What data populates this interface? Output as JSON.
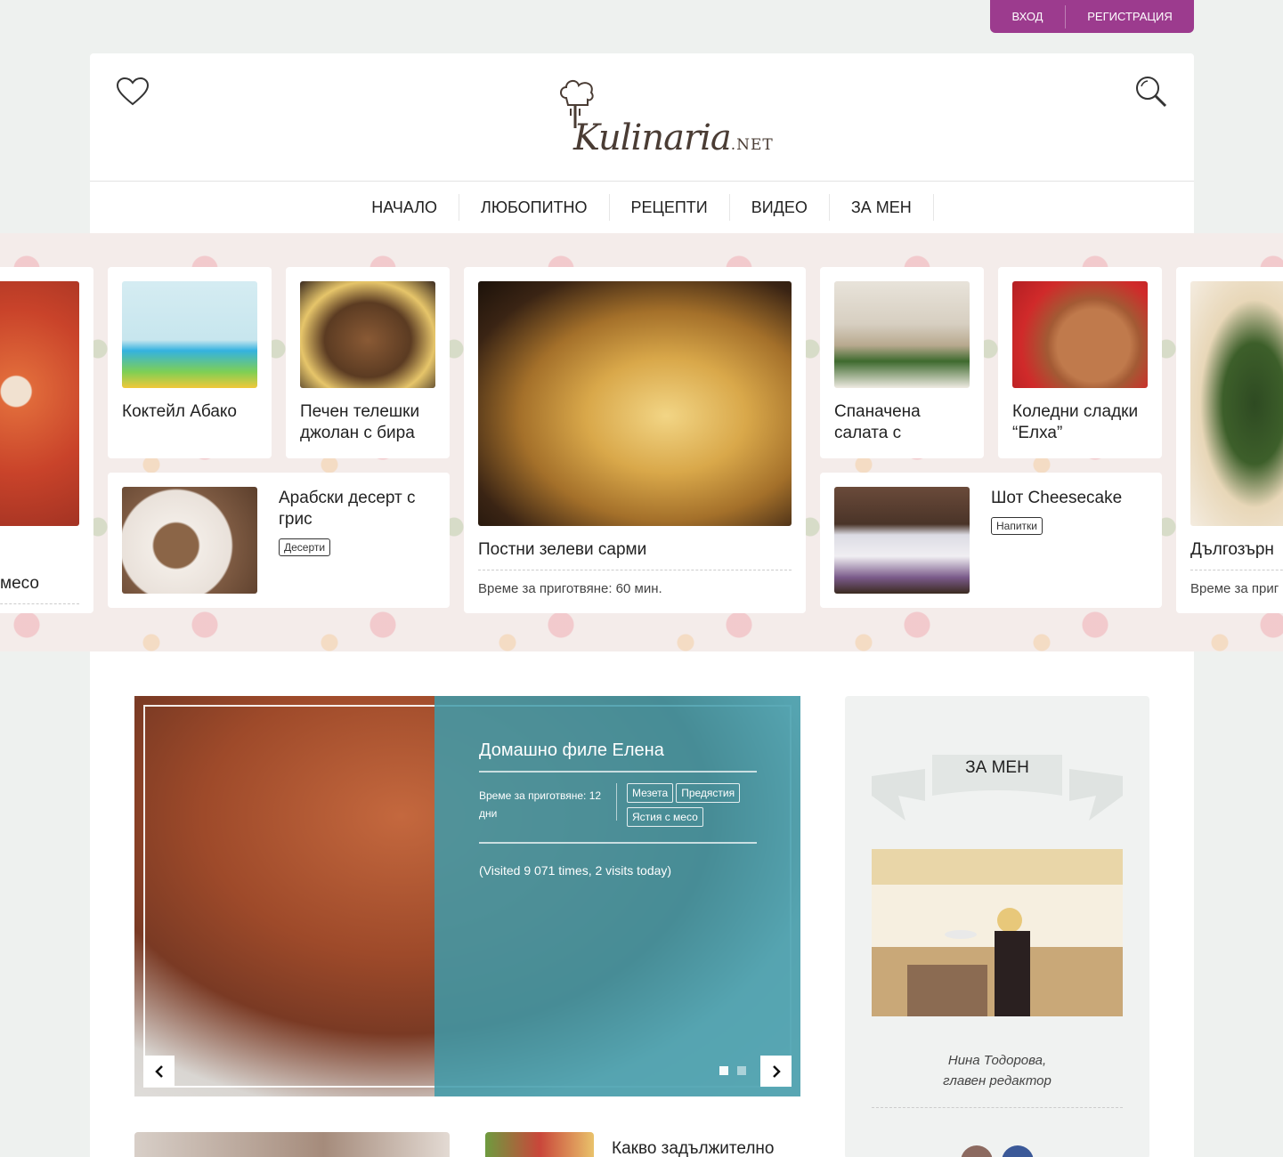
{
  "auth": {
    "login": "ВХОД",
    "register": "РЕГИСТРАЦИЯ"
  },
  "header": {
    "logo_text": "Kulinaria",
    "logo_suffix": ".NET"
  },
  "nav": {
    "items": [
      {
        "label": "НАЧАЛО"
      },
      {
        "label": "ЛЮБОПИТНО"
      },
      {
        "label": "РЕЦЕПТИ"
      },
      {
        "label": "ВИДЕО"
      },
      {
        "label": "ЗА МЕН"
      }
    ]
  },
  "strip": {
    "left_partial": {
      "title": "месо"
    },
    "cards": [
      {
        "title": "Коктейл Абако"
      },
      {
        "title": "Печен телешки джолан с бира"
      },
      {
        "title": "Арабски десерт с грис",
        "tag": "Десерти"
      },
      {
        "title": "Постни зелеви сарми",
        "meta": "Време за приготвяне: 60 мин."
      },
      {
        "title": "Спаначена салата с"
      },
      {
        "title": "Коледни сладки “Елха”"
      },
      {
        "title": "Шот Cheesecake",
        "tag": "Напитки"
      }
    ],
    "right_partial": {
      "title": "Дългозърн",
      "meta": "Време за приг"
    }
  },
  "slider": {
    "title": "Домашно филе Елена",
    "time": "Време за приготвяне: 12 дни",
    "tags": [
      "Мезета",
      "Предястия",
      "Ястия с месо"
    ],
    "visits": "(Visited 9 071 times, 2 visits today)"
  },
  "sidebar": {
    "heading": "ЗА МЕН",
    "name_line1": "Нина Тодорова,",
    "name_line2": "главен редактор"
  },
  "bottom": {
    "title": "Какво задължително"
  },
  "colors": {
    "accent": "#9c3b8e",
    "slider_panel": "#3e9baa"
  }
}
